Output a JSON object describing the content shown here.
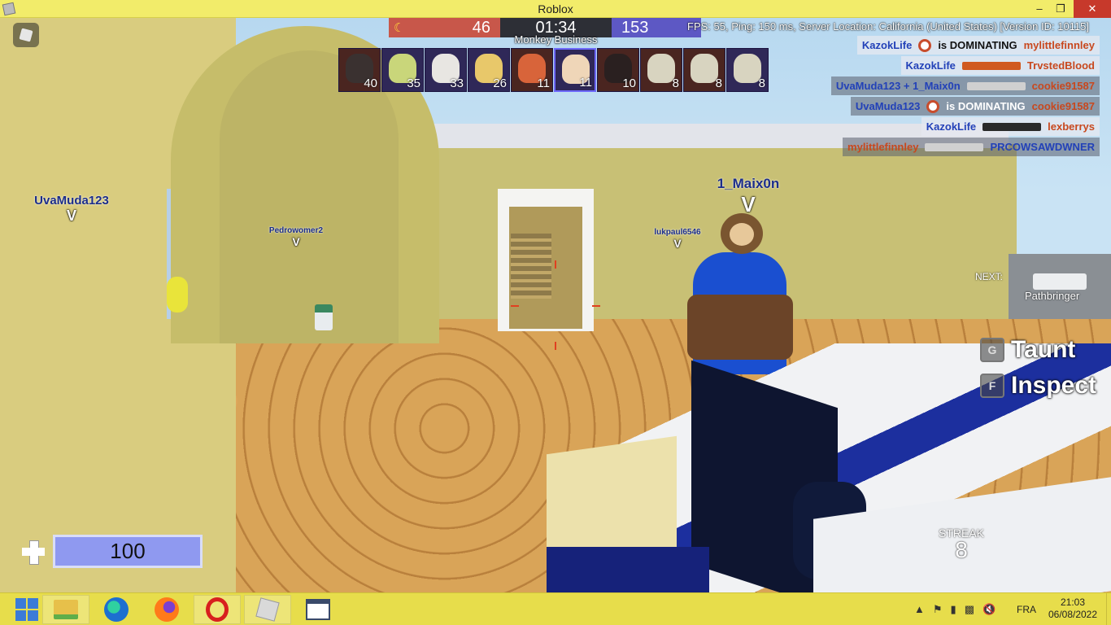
{
  "window": {
    "title": "Roblox",
    "controls": [
      "minimize",
      "restore",
      "close"
    ]
  },
  "hud": {
    "score_left": "46",
    "timer": "01:34",
    "score_right": "153",
    "mode": "Monkey Business",
    "fps_info": "FPS: 55, Ping: 150 ms, Server Location: California (United States) [Version ID: 10115]",
    "portraits": [
      {
        "count": "40",
        "team": "red",
        "face": "#3a3130"
      },
      {
        "count": "35",
        "team": "blue",
        "face": "#c9d67a"
      },
      {
        "count": "33",
        "team": "blue",
        "face": "#e8e6e2"
      },
      {
        "count": "26",
        "team": "blue",
        "face": "#e8c86a"
      },
      {
        "count": "11",
        "team": "red",
        "face": "#d8643a"
      },
      {
        "count": "11",
        "team": "blue",
        "face": "#efd6b8",
        "selected": true
      },
      {
        "count": "10",
        "team": "red",
        "face": "#2a2020"
      },
      {
        "count": "8",
        "team": "red",
        "face": "#d8d4c0"
      },
      {
        "count": "8",
        "team": "red",
        "face": "#d8d4c0"
      },
      {
        "count": "8",
        "team": "blue",
        "face": "#d8d4c0"
      }
    ],
    "killfeed": [
      {
        "killer": "KazokLife",
        "middle": "is DOMINATING",
        "victim": "mylittlefinnley",
        "style": "light",
        "killer_color": "blue",
        "victim_color": "red",
        "icon": "dot"
      },
      {
        "killer": "KazokLife",
        "middle": "",
        "victim": "TrvstedBlood",
        "style": "light",
        "killer_color": "blue",
        "victim_color": "red",
        "icon": "gun-orange"
      },
      {
        "killer": "UvaMuda123 + 1_Maix0n",
        "middle": "",
        "victim": "cookie91587",
        "style": "dark",
        "killer_color": "blue",
        "victim_color": "red",
        "icon": "gun-grey"
      },
      {
        "killer": "UvaMuda123",
        "middle": "is DOMINATING",
        "victim": "cookie91587",
        "style": "dark",
        "killer_color": "blue",
        "victim_color": "red",
        "icon": "dot"
      },
      {
        "killer": "KazokLife",
        "middle": "",
        "victim": "lexberrys",
        "style": "light",
        "killer_color": "blue",
        "victim_color": "red",
        "icon": "gun-dark"
      },
      {
        "killer": "mylittlefinnley",
        "middle": "",
        "victim": "PRCOWSAWDWNER",
        "style": "dark",
        "killer_color": "red",
        "victim_color": "blue",
        "icon": "gun-grey"
      }
    ],
    "next_label": "NEXT:",
    "next_weapon": "Pathbringer",
    "hints": [
      {
        "key": "G",
        "label": "Taunt"
      },
      {
        "key": "F",
        "label": "Inspect"
      }
    ],
    "streak_label": "STREAK",
    "streak_value": "8",
    "health": "100"
  },
  "players": [
    {
      "name": "UvaMuda123",
      "marker": "V"
    },
    {
      "name": "Pedrowomer2",
      "marker": "V"
    },
    {
      "name": "lukpaul6546",
      "marker": "V"
    },
    {
      "name": "1_Maix0n",
      "marker": "V"
    }
  ],
  "taskbar": {
    "apps": [
      "start",
      "file-explorer",
      "edge",
      "firefox",
      "opera",
      "roblox",
      "window-app"
    ],
    "language": "FRA",
    "time": "21:03",
    "date": "06/08/2022"
  },
  "colors": {
    "team_red": "#c8574a",
    "team_blue": "#5d58c4",
    "health": "#8f99f0",
    "taskbar": "#e7dd4b",
    "titlebar": "#f2ec6a"
  }
}
